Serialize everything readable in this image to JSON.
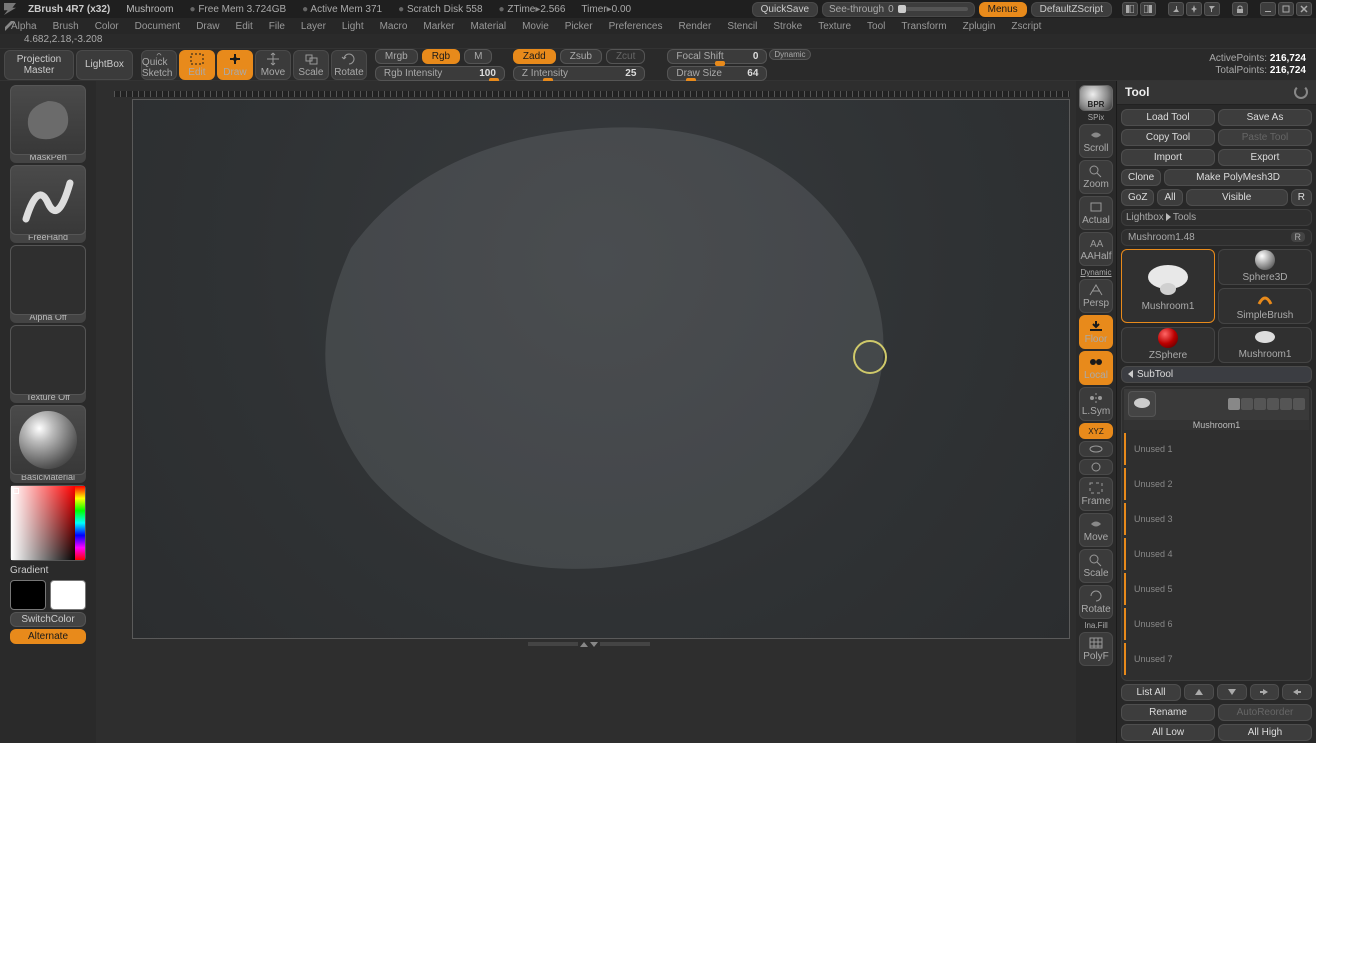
{
  "title": {
    "app": "ZBrush 4R7 (x32)",
    "project": "Mushroom",
    "freemem": "Free Mem 3.724GB",
    "activemem": "Active Mem 371",
    "scratch": "Scratch Disk 558",
    "ztime": "ZTime",
    "ztime_val": "2.566",
    "timer": "Timer",
    "timer_val": "0.00"
  },
  "topbtns": {
    "quicksave": "QuickSave",
    "see": "See-through",
    "see_val": "0",
    "menus": "Menus",
    "defscript": "DefaultZScript"
  },
  "menu": [
    "Alpha",
    "Brush",
    "Color",
    "Document",
    "Draw",
    "Edit",
    "File",
    "Layer",
    "Light",
    "Macro",
    "Marker",
    "Material",
    "Movie",
    "Picker",
    "Preferences",
    "Render",
    "Stencil",
    "Stroke",
    "Texture",
    "Tool",
    "Transform",
    "Zplugin",
    "Zscript"
  ],
  "coords": "4.682,2.18,-3.208",
  "toolbar": {
    "proj": "Projection Master",
    "lightbox": "LightBox",
    "quicksketch": "Quick Sketch",
    "edit": "Edit",
    "draw": "Draw",
    "move": "Move",
    "scale": "Scale",
    "rotate": "Rotate",
    "mrgb": "Mrgb",
    "rgb": "Rgb",
    "m": "M",
    "zadd": "Zadd",
    "zsub": "Zsub",
    "zcut": "Zcut",
    "rgbint": "Rgb Intensity",
    "rgbint_val": "100",
    "zint": "Z Intensity",
    "zint_val": "25",
    "focal": "Focal Shift",
    "focal_val": "0",
    "drawsize": "Draw Size",
    "drawsize_val": "64",
    "dynamic": "Dynamic",
    "active": "ActivePoints:",
    "active_val": "216,724",
    "total": "TotalPoints:",
    "total_val": "216,724"
  },
  "left": {
    "brush": "MaskPen",
    "stroke": "FreeHand",
    "alpha": "Alpha Off",
    "texture": "Texture Off",
    "material": "BasicMaterial",
    "gradient": "Gradient",
    "switch": "SwitchColor",
    "alternate": "Alternate"
  },
  "rightstrip": {
    "bpr": "BPR",
    "spix": "SPix",
    "scroll": "Scroll",
    "zoom": "Zoom",
    "actual": "Actual",
    "aahalf": "AAHalf",
    "dynamic": "Dynamic",
    "persp": "Persp",
    "floor": "Floor",
    "local": "Local",
    "lsym": "L.Sym",
    "xyz": "XYZ",
    "frame": "Frame",
    "move": "Move",
    "scale": "Scale",
    "rotate": "Rotate",
    "inafill": "Ina.Fill",
    "polyf": "PolyF"
  },
  "tool": {
    "header": "Tool",
    "load": "Load Tool",
    "save": "Save As",
    "copy": "Copy Tool",
    "paste": "Paste Tool",
    "import": "Import",
    "export": "Export",
    "clone": "Clone",
    "makepoly": "Make PolyMesh3D",
    "goz": "GoZ",
    "all": "All",
    "visible": "Visible",
    "r": "R",
    "lightbox": "Lightbox",
    "tools": "Tools",
    "toolname": "Mushroom1.48",
    "current": "Mushroom1",
    "sphere": "Sphere3D",
    "simplebrush": "SimpleBrush",
    "zsphere": "ZSphere",
    "mushroom": "Mushroom1"
  },
  "subtool": {
    "header": "SubTool",
    "item": "Mushroom1",
    "unused": [
      "Unused 1",
      "Unused 2",
      "Unused 3",
      "Unused 4",
      "Unused 5",
      "Unused 6",
      "Unused 7"
    ],
    "listall": "List All",
    "rename": "Rename",
    "autoreorder": "AutoReorder",
    "alllow": "All Low",
    "allhigh": "All High"
  }
}
